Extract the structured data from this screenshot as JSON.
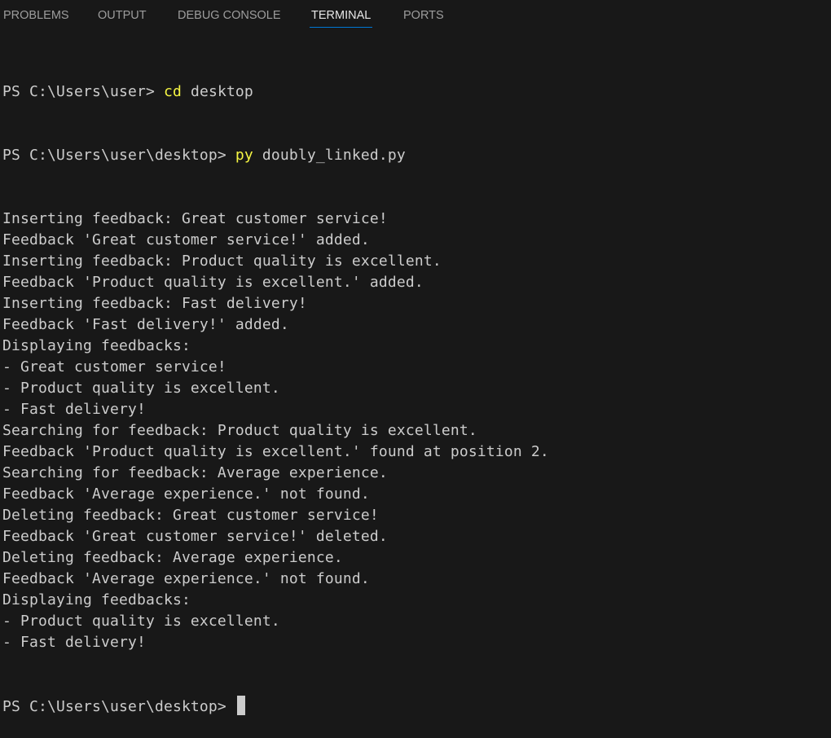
{
  "panel": {
    "tabs": [
      {
        "label": "PROBLEMS",
        "active": false
      },
      {
        "label": "OUTPUT",
        "active": false
      },
      {
        "label": "DEBUG CONSOLE",
        "active": false
      },
      {
        "label": "TERMINAL",
        "active": true
      },
      {
        "label": "PORTS",
        "active": false
      }
    ],
    "accent_color": "#0078d4"
  },
  "terminal": {
    "commands": [
      {
        "prompt": "PS C:\\Users\\user> ",
        "cmd": "cd",
        "args": " desktop"
      },
      {
        "prompt": "PS C:\\Users\\user\\desktop> ",
        "cmd": "py",
        "args": " doubly_linked.py"
      }
    ],
    "output": [
      "Inserting feedback: Great customer service!",
      "Feedback 'Great customer service!' added.",
      "Inserting feedback: Product quality is excellent.",
      "Feedback 'Product quality is excellent.' added.",
      "Inserting feedback: Fast delivery!",
      "Feedback 'Fast delivery!' added.",
      "Displaying feedbacks:",
      "- Great customer service!",
      "- Product quality is excellent.",
      "- Fast delivery!",
      "Searching for feedback: Product quality is excellent.",
      "Feedback 'Product quality is excellent.' found at position 2.",
      "Searching for feedback: Average experience.",
      "Feedback 'Average experience.' not found.",
      "Deleting feedback: Great customer service!",
      "Feedback 'Great customer service!' deleted.",
      "Deleting feedback: Average experience.",
      "Feedback 'Average experience.' not found.",
      "Displaying feedbacks:",
      "- Product quality is excellent.",
      "- Fast delivery!"
    ],
    "final_prompt": "PS C:\\Users\\user\\desktop> "
  }
}
